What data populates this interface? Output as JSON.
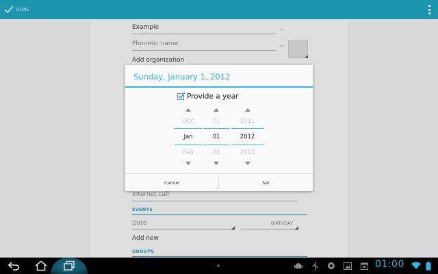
{
  "action_bar": {
    "done_label": "DONE",
    "accent": "#1d95ad"
  },
  "form": {
    "name_value": "Example",
    "phonetic_placeholder": "Phonetic name",
    "add_org_label": "Add organization",
    "internet_call_label": "Internet call",
    "events_header": "EVENTS",
    "date_label": "Date",
    "birthday_label": "BIRTHDAY",
    "add_new_label": "Add new",
    "groups_header": "GROUPS"
  },
  "dialog": {
    "title": "Sunday, January 1, 2012",
    "provide_year_label": "Provide a year",
    "provide_year_checked": true,
    "pickers": {
      "month": {
        "prev": "Dec",
        "current": "Jan",
        "next": "Feb"
      },
      "day": {
        "prev": "31",
        "current": "01",
        "next": "02"
      },
      "year": {
        "prev": "2011",
        "current": "2012",
        "next": "2013"
      }
    },
    "cancel_label": "Cancel",
    "set_label": "Set",
    "accent": "#33b5e5"
  },
  "system_bar": {
    "clock": "01:00",
    "clock_color": "#33b5e5",
    "icons": [
      "back-icon",
      "home-icon",
      "recent-apps-icon",
      "android-debug-icon",
      "usb-icon",
      "sync-icon",
      "gallery-icon",
      "calendar-icon",
      "wifi-icon",
      "battery-icon"
    ]
  }
}
